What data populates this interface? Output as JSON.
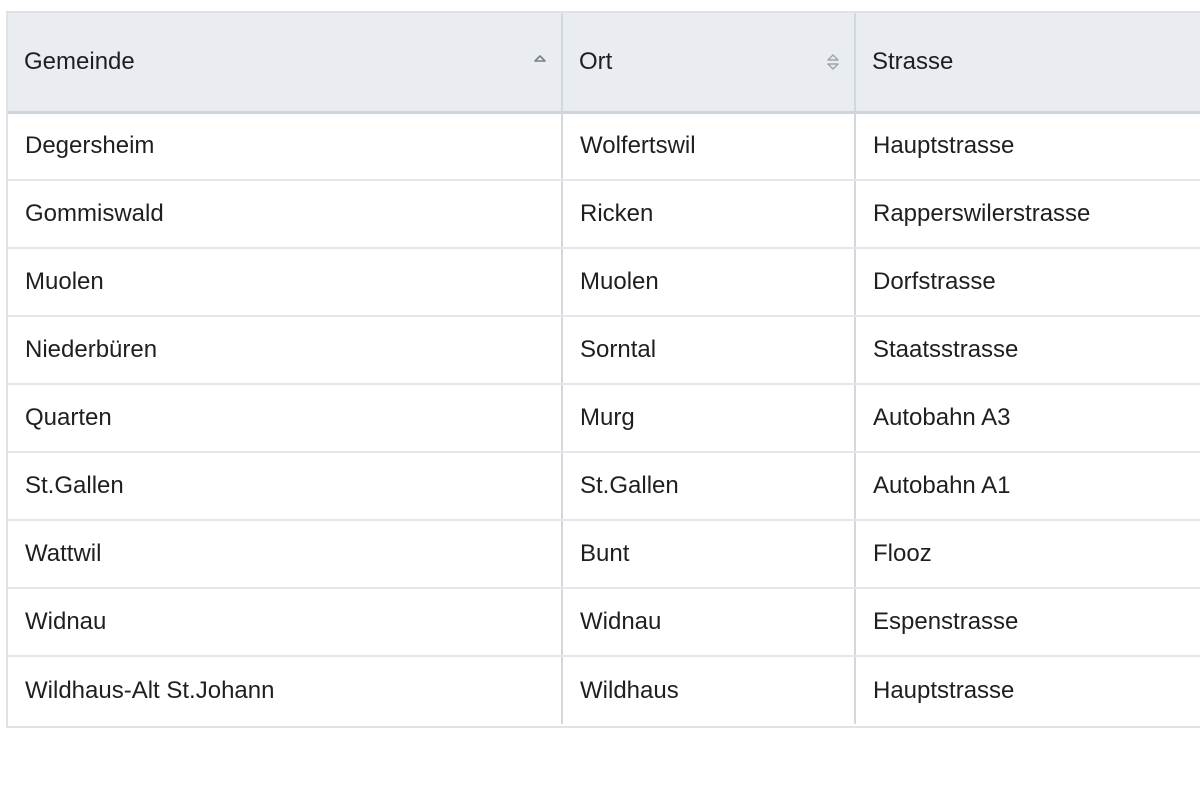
{
  "table": {
    "columns": [
      {
        "label": "Gemeinde",
        "sort": "ascending",
        "sort_icon": "sort-ascending-icon"
      },
      {
        "label": "Ort",
        "sort": "none",
        "sort_icon": "sort-both-icon"
      },
      {
        "label": "Strasse",
        "sort": "none"
      }
    ],
    "rows": [
      [
        "Degersheim",
        "Wolfertswil",
        "Hauptstrasse"
      ],
      [
        "Gommiswald",
        "Ricken",
        "Rapperswilerstrasse"
      ],
      [
        "Muolen",
        "Muolen",
        "Dorfstrasse"
      ],
      [
        "Niederbüren",
        "Sorntal",
        "Staatsstrasse"
      ],
      [
        "Quarten",
        "Murg",
        "Autobahn A3"
      ],
      [
        "St.Gallen",
        "St.Gallen",
        "Autobahn A1"
      ],
      [
        "Wattwil",
        "Bunt",
        "Flooz"
      ],
      [
        "Widnau",
        "Widnau",
        "Espenstrasse"
      ],
      [
        "Wildhaus-Alt St.Johann",
        "Wildhaus",
        "Hauptstrasse"
      ]
    ]
  },
  "colors": {
    "header_bg": "#e9ecf1",
    "border": "#d3d8df",
    "text": "#1f1f1f",
    "icon": "#8a8f96"
  }
}
